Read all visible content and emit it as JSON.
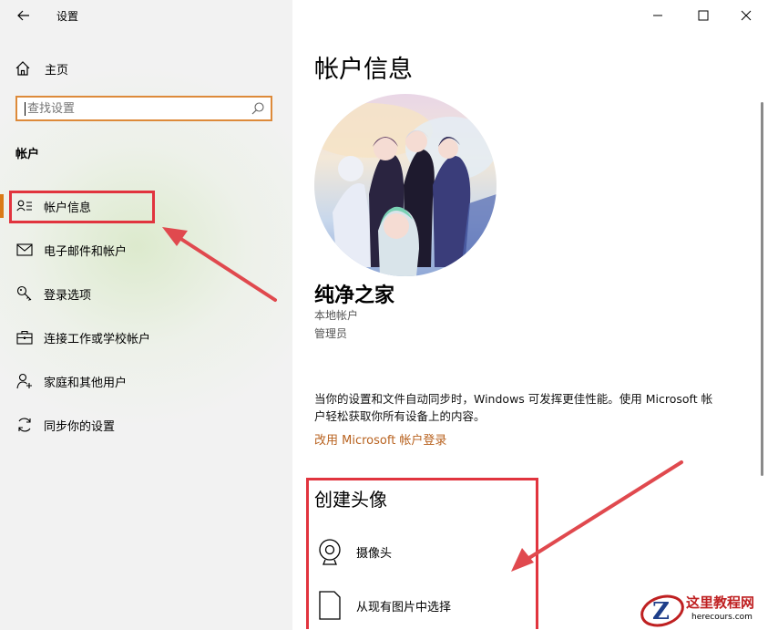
{
  "window": {
    "title": "设置",
    "controls": [
      "minimize-icon",
      "maximize-icon",
      "close-icon"
    ]
  },
  "sidebar": {
    "home_label": "主页",
    "search_placeholder": "查找设置",
    "section_title": "帐户",
    "items": [
      {
        "label": "帐户信息",
        "icon": "account-info-icon",
        "active": true
      },
      {
        "label": "电子邮件和帐户",
        "icon": "mail-icon"
      },
      {
        "label": "登录选项",
        "icon": "key-icon"
      },
      {
        "label": "连接工作或学校帐户",
        "icon": "briefcase-icon"
      },
      {
        "label": "家庭和其他用户",
        "icon": "person-add-icon"
      },
      {
        "label": "同步你的设置",
        "icon": "sync-icon"
      }
    ]
  },
  "main": {
    "title": "帐户信息",
    "user_name": "纯净之家",
    "account_type": "本地帐户",
    "role": "管理员",
    "info_text": "当你的设置和文件自动同步时，Windows 可发挥更佳性能。使用 Microsoft 帐户轻松获取你所有设备上的内容。",
    "link_text": "改用 Microsoft 帐户登录",
    "create_avatar_title": "创建头像",
    "options": [
      {
        "label": "摄像头",
        "icon": "webcam-icon"
      },
      {
        "label": "从现有图片中选择",
        "icon": "image-file-icon"
      }
    ]
  },
  "watermark": {
    "logo_letter": "Z",
    "title": "这里教程网",
    "url": "herecours.com"
  },
  "colors": {
    "accent": "#da7a17",
    "link": "#b8621f",
    "highlight_box": "#e1343e",
    "sidebar_bg": "#f2f2f2"
  }
}
